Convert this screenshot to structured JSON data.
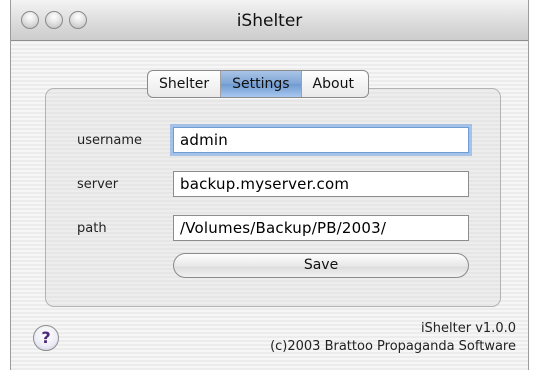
{
  "window": {
    "title": "iShelter"
  },
  "tabs": [
    {
      "label": "Shelter",
      "active": false
    },
    {
      "label": "Settings",
      "active": true
    },
    {
      "label": "About",
      "active": false
    }
  ],
  "form": {
    "username": {
      "label": "username",
      "value": "admin"
    },
    "server": {
      "label": "server",
      "value": "backup.myserver.com"
    },
    "path": {
      "label": "path",
      "value": "/Volumes/Backup/PB/2003/"
    },
    "save_label": "Save"
  },
  "footer": {
    "help_label": "?",
    "version": "iShelter v1.0.0",
    "copyright": "(c)2003 Brattoo Propaganda Software"
  },
  "colors": {
    "active_tab": "#7ea5d6",
    "focus_ring": "#6f9bd9",
    "help_glyph": "#4a2a78"
  }
}
